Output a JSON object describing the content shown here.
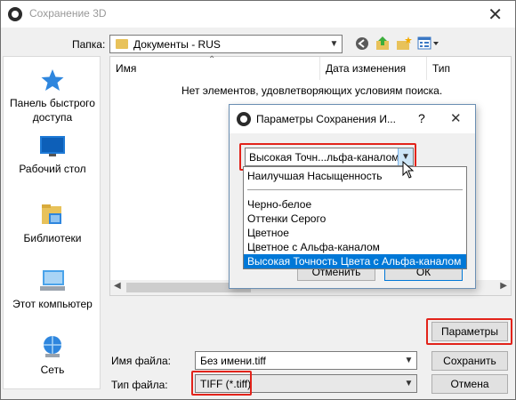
{
  "window": {
    "title": "Сохранение 3D",
    "close_glyph": "✕"
  },
  "location": {
    "label": "Папка:",
    "folder": "Документы - RUS"
  },
  "sidebar": {
    "items": [
      {
        "label": "Панель быстрого доступа",
        "icon": "star-icon"
      },
      {
        "label": "Рабочий стол",
        "icon": "desktop-icon"
      },
      {
        "label": "Библиотеки",
        "icon": "libraries-icon"
      },
      {
        "label": "Этот компьютер",
        "icon": "computer-icon"
      },
      {
        "label": "Сеть",
        "icon": "network-icon"
      }
    ]
  },
  "file_list": {
    "columns": [
      "Имя",
      "Дата изменения",
      "Тип"
    ],
    "empty_message": "Нет элементов, удовлетворяющих условиям поиска."
  },
  "form": {
    "filename_label": "Имя файла:",
    "filename_value": "Без имени.tiff",
    "filetype_label": "Тип файла:",
    "filetype_value": "TIFF (*.tiff)"
  },
  "buttons": {
    "params": "Параметры",
    "save": "Сохранить",
    "cancel": "Отмена"
  },
  "dialog": {
    "title": "Параметры Сохранения И...",
    "help": "?",
    "close": "✕",
    "selected": "Высокая Точн...льфа-каналом",
    "options": [
      "Наилучшая Насыщенность",
      "Черно-белое",
      "Оттенки Серого",
      "Цветное",
      "Цветное с Альфа-каналом",
      "Высокая Точность Цвета с Альфа-каналом"
    ],
    "cancel_label": "Отменить",
    "ok_label": "ОК"
  },
  "colors": {
    "highlight": "#e2231a",
    "selection": "#0078d7"
  }
}
